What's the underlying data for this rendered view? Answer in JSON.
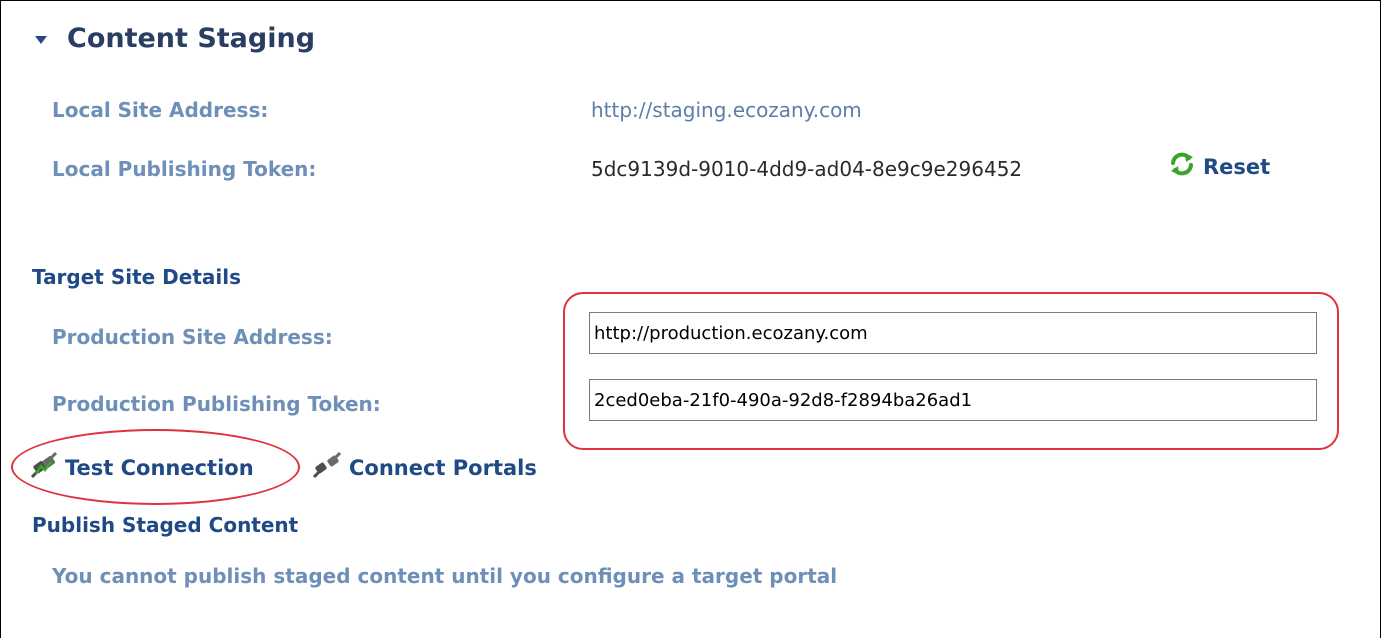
{
  "content_staging": {
    "title": "Content Staging",
    "local_site_address": {
      "label": "Local Site Address:",
      "value": "http://staging.ecozany.com"
    },
    "local_publishing_token": {
      "label": "Local Publishing Token:",
      "value": "5dc9139d-9010-4dd9-ad04-8e9c9e296452",
      "reset_label": "Reset"
    }
  },
  "target_site_details": {
    "heading": "Target Site Details",
    "production_site_address": {
      "label": "Production Site Address:",
      "value": "http://production.ecozany.com"
    },
    "production_publishing_token": {
      "label": "Production Publishing Token:",
      "value": "2ced0eba-21f0-490a-92d8-f2894ba26ad1"
    }
  },
  "actions": {
    "test_connection": "Test Connection",
    "connect_portals": "Connect Portals"
  },
  "publish_staged_content": {
    "heading": "Publish Staged Content",
    "message": "You cannot publish staged content until you configure a target portal"
  },
  "colors": {
    "highlight": "#e0323c",
    "heading_blue": "#1f4a85",
    "label_blue": "#6e8fb7",
    "refresh_green": "#3aa52a"
  },
  "icons": {
    "collapse": "caret-down-icon",
    "reset": "refresh-icon",
    "test_connection": "plug-connected-icon",
    "connect_portals": "plug-icon"
  }
}
